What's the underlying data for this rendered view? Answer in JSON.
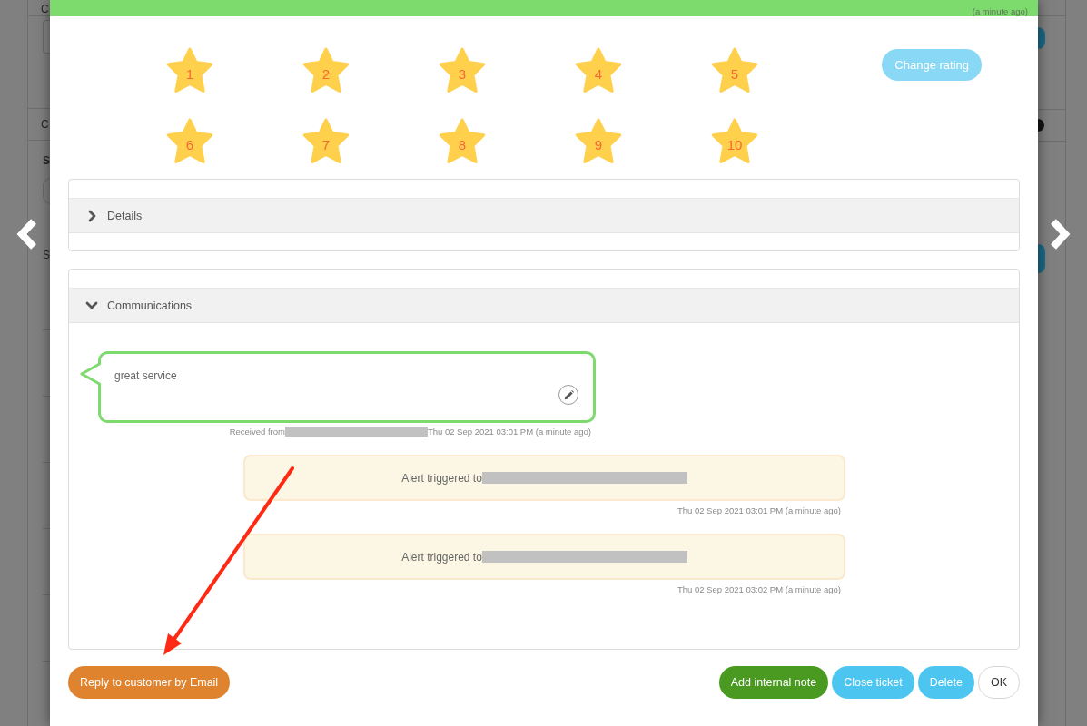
{
  "background_page": {
    "texts": [
      {
        "text": "C",
        "bold": false
      },
      {
        "text": "C",
        "bold": false
      },
      {
        "text": "S",
        "bold": true
      },
      {
        "text": "S",
        "bold": false
      }
    ]
  },
  "modal": {
    "header": {
      "time_note": "(a minute ago)"
    },
    "rating": {
      "star_labels": [
        "1",
        "2",
        "3",
        "4",
        "5",
        "6",
        "7",
        "8",
        "9",
        "10"
      ],
      "change_button": {
        "label": "Change rating",
        "disabled": true
      }
    },
    "sections": [
      {
        "title": "Details",
        "expanded": false
      },
      {
        "title": "Communications",
        "expanded": true,
        "items": [
          {
            "kind": "message",
            "text": "great service",
            "meta_prefix": "Received from",
            "redacted": true,
            "timestamp": "Thu 02 Sep 2021 03:01 PM (a minute ago)"
          },
          {
            "kind": "alert",
            "text": "Alert triggered to",
            "redacted": true,
            "timestamp": "Thu 02 Sep 2021 03:01 PM (a minute ago)"
          },
          {
            "kind": "alert",
            "text": "Alert triggered to",
            "redacted": true,
            "timestamp": "Thu 02 Sep 2021 03:02 PM (a minute ago)"
          }
        ]
      }
    ],
    "footer": {
      "left_buttons": [
        {
          "label": "Reply to customer by Email",
          "kind": "warning"
        }
      ],
      "right_buttons": [
        {
          "label": "Add internal note",
          "kind": "success"
        },
        {
          "label": "Close ticket",
          "kind": "info"
        },
        {
          "label": "Delete",
          "kind": "info"
        },
        {
          "label": "OK",
          "kind": "default"
        }
      ]
    }
  }
}
